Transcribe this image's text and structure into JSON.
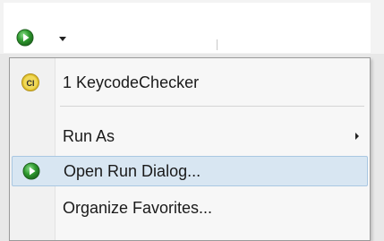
{
  "toolbar": {
    "run_button": {
      "icon": "run-icon",
      "color": "#2f9a2f"
    },
    "dropdown": {
      "icon": "chevron-down-icon"
    }
  },
  "menu": {
    "items": [
      {
        "label": "1 KeycodeChecker",
        "icon": "java-class-icon",
        "badge_text": "CI"
      },
      {
        "label": "Run As",
        "icon": "",
        "has_submenu": true
      },
      {
        "label": "Open Run Dialog...",
        "icon": "run-icon",
        "highlighted": true
      },
      {
        "label": "Organize Favorites...",
        "icon": ""
      }
    ]
  },
  "colors": {
    "highlight_bg": "#d8e6f2",
    "highlight_border": "#a9c7e2",
    "run_green": "#2f9a2f",
    "class_icon_yellow": "#e2c332"
  }
}
